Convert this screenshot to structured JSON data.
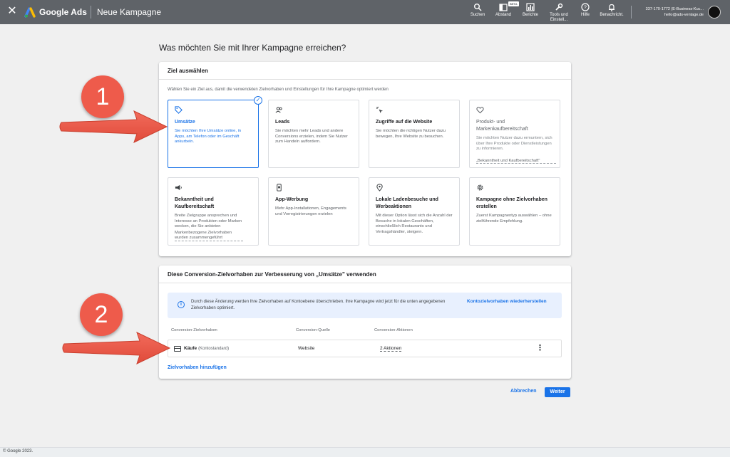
{
  "topbar": {
    "close_icon": "close-icon",
    "brand": "Google Ads",
    "page_name": "Neue Kampagne",
    "tools": [
      {
        "icon": "search-icon",
        "label": "Suchen"
      },
      {
        "icon": "appearance-icon",
        "label": "Abstand"
      },
      {
        "icon": "reports-icon",
        "label": "Berichte"
      },
      {
        "icon": "wrench-icon",
        "label": "Tools und Einstell..."
      },
      {
        "icon": "help-icon",
        "label": "Hilfe"
      },
      {
        "icon": "bell-icon",
        "label": "Benachricht."
      }
    ],
    "beta_label": "BETA",
    "account_id": "337-170-1772 (E-Business-Kuc...",
    "account_email": "hello@ads-ventage.de"
  },
  "page": {
    "title": "Was möchten Sie mit Ihrer Kampagne erreichen?"
  },
  "goal_section": {
    "header": "Ziel auswählen",
    "description": "Wählen Sie ein Ziel aus, damit die verwendeten Zielvorhaben und Einstellungen für Ihre Kampagne optimiert werden",
    "tiles": [
      {
        "icon": "tag-icon",
        "title": "Umsätze",
        "text": "Sie möchten Ihre Umsätze online, in Apps, am Telefon oder im Geschäft ankurbeln.",
        "selected": true
      },
      {
        "icon": "people-icon",
        "title": "Leads",
        "text": "Sie möchten mehr Leads und andere Conversions erzielen, indem Sie Nutzer zum Handeln auffordern."
      },
      {
        "icon": "cursor-click-icon",
        "title": "Zugriffe auf die Website",
        "text": "Sie möchten die richtigen Nutzer dazu bewegen, Ihre Website zu besuchen."
      },
      {
        "icon": "heart-icon",
        "title": "Produkt- und Markenkaufbereitschaft",
        "text": "Sie möchten Nutzer dazu ermuntern, sich über Ihre Produkte oder Dienstleistungen zu informieren.",
        "footnote": "„Bekanntheit und Kaufbereitschaft\" verwenden",
        "muted": true
      },
      {
        "icon": "megaphone-icon",
        "title": "Bekanntheit und Kaufbereitschaft",
        "text": "Breite Zielgruppe ansprechen und Interesse an Produkten oder Marken wecken, die Sie anbieten",
        "footnote": "Markenbezogene Zielvorhaben wurden zusammengeführt"
      },
      {
        "icon": "phone-icon",
        "title": "App-Werbung",
        "text": "Mehr App-Installationen, Engagements und Vorregistrierungen erzielen"
      },
      {
        "icon": "pin-icon",
        "title": "Lokale Ladenbesuche und Werbeaktionen",
        "text": "Mit dieser Option lässt sich die Anzahl der Besuche in lokalen Geschäften, einschließlich Restaurants und Vertragshändler, steigern."
      },
      {
        "icon": "gear-icon",
        "title": "Kampagne ohne Zielvorhaben erstellen",
        "text": "Zuerst Kampagnentyp auswählen – ohne zielführende Empfehlung."
      }
    ]
  },
  "conversion_section": {
    "header": "Diese Conversion-Zielvorhaben zur Verbesserung von „Umsätze\" verwenden",
    "info_text": "Durch diese Änderung werden Ihre Zielvorhaben auf Kontoebene überschrieben. Ihre Kampagne wird jetzt für die unten angegebenen Zielvorhaben optimiert.",
    "info_link": "Kontozielvorhaben wiederherstellen",
    "columns": [
      "Conversion-Zielvorhaben",
      "Conversion-Quelle",
      "Conversion-Aktionen"
    ],
    "row": {
      "name": "Käufe",
      "default_label": "(Kontostandard)",
      "source": "Website",
      "actions": "2 Aktionen"
    },
    "add_link": "Zielvorhaben hinzufügen"
  },
  "buttons": {
    "cancel": "Abbrechen",
    "next": "Weiter"
  },
  "annotations": {
    "marker_1": "1",
    "marker_2": "2",
    "marker_color": "#ee5b4b"
  },
  "footer": {
    "copyright": "© Google 2023."
  }
}
